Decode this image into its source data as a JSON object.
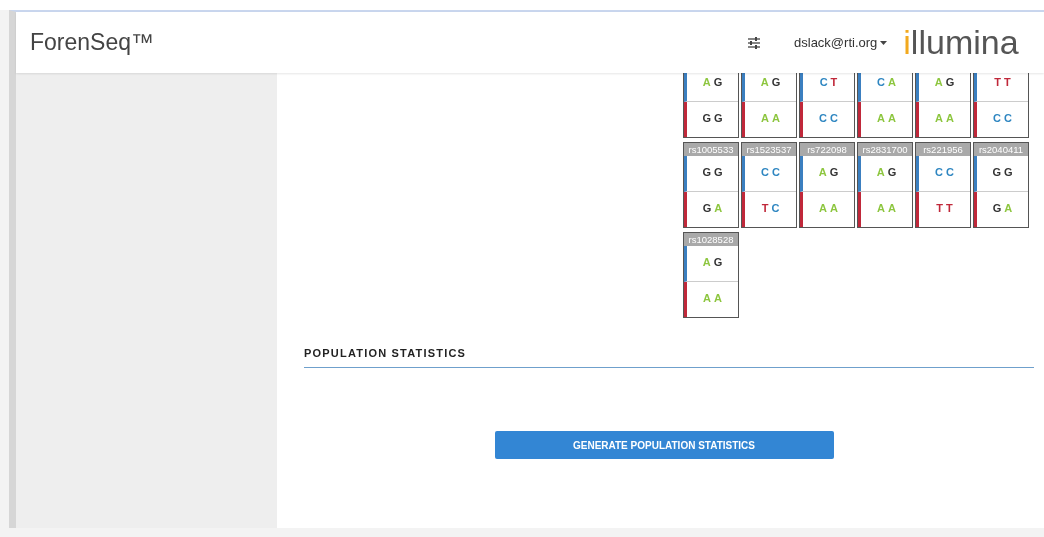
{
  "header": {
    "brand": "ForenSeq™",
    "user": "dslack@rti.org",
    "logo": "illumina"
  },
  "cards": [
    {
      "top": [
        {
          "base": "A",
          "color": "#8dc63f"
        },
        {
          "base": "G",
          "color": "#333333"
        }
      ],
      "bottom": [
        {
          "base": "G",
          "color": "#333333"
        },
        {
          "base": "G",
          "color": "#333333"
        }
      ]
    },
    {
      "top": [
        {
          "base": "A",
          "color": "#8dc63f"
        },
        {
          "base": "G",
          "color": "#333333"
        }
      ],
      "bottom": [
        {
          "base": "A",
          "color": "#8dc63f"
        },
        {
          "base": "A",
          "color": "#8dc63f"
        }
      ]
    },
    {
      "top": [
        {
          "base": "C",
          "color": "#2e86c1"
        },
        {
          "base": "T",
          "color": "#c0283a"
        }
      ],
      "bottom": [
        {
          "base": "C",
          "color": "#2e86c1"
        },
        {
          "base": "C",
          "color": "#2e86c1"
        }
      ]
    },
    {
      "top": [
        {
          "base": "C",
          "color": "#2e86c1"
        },
        {
          "base": "A",
          "color": "#8dc63f"
        }
      ],
      "bottom": [
        {
          "base": "A",
          "color": "#8dc63f"
        },
        {
          "base": "A",
          "color": "#8dc63f"
        }
      ]
    },
    {
      "top": [
        {
          "base": "A",
          "color": "#8dc63f"
        },
        {
          "base": "G",
          "color": "#333333"
        }
      ],
      "bottom": [
        {
          "base": "A",
          "color": "#8dc63f"
        },
        {
          "base": "A",
          "color": "#8dc63f"
        }
      ]
    },
    {
      "top": [
        {
          "base": "T",
          "color": "#c0283a"
        },
        {
          "base": "T",
          "color": "#c0283a"
        }
      ],
      "bottom": [
        {
          "base": "C",
          "color": "#2e86c1"
        },
        {
          "base": "C",
          "color": "#2e86c1"
        }
      ]
    },
    {
      "label": "rs1005533",
      "top": [
        {
          "base": "G",
          "color": "#333333"
        },
        {
          "base": "G",
          "color": "#333333"
        }
      ],
      "bottom": [
        {
          "base": "G",
          "color": "#333333"
        },
        {
          "base": "A",
          "color": "#8dc63f"
        }
      ]
    },
    {
      "label": "rs1523537",
      "top": [
        {
          "base": "C",
          "color": "#2e86c1"
        },
        {
          "base": "C",
          "color": "#2e86c1"
        }
      ],
      "bottom": [
        {
          "base": "T",
          "color": "#c0283a"
        },
        {
          "base": "C",
          "color": "#2e86c1"
        }
      ]
    },
    {
      "label": "rs722098",
      "top": [
        {
          "base": "A",
          "color": "#8dc63f"
        },
        {
          "base": "G",
          "color": "#333333"
        }
      ],
      "bottom": [
        {
          "base": "A",
          "color": "#8dc63f"
        },
        {
          "base": "A",
          "color": "#8dc63f"
        }
      ]
    },
    {
      "label": "rs2831700",
      "top": [
        {
          "base": "A",
          "color": "#8dc63f"
        },
        {
          "base": "G",
          "color": "#333333"
        }
      ],
      "bottom": [
        {
          "base": "A",
          "color": "#8dc63f"
        },
        {
          "base": "A",
          "color": "#8dc63f"
        }
      ]
    },
    {
      "label": "rs221956",
      "top": [
        {
          "base": "C",
          "color": "#2e86c1"
        },
        {
          "base": "C",
          "color": "#2e86c1"
        }
      ],
      "bottom": [
        {
          "base": "T",
          "color": "#c0283a"
        },
        {
          "base": "T",
          "color": "#c0283a"
        }
      ]
    },
    {
      "label": "rs2040411",
      "top": [
        {
          "base": "G",
          "color": "#333333"
        },
        {
          "base": "G",
          "color": "#333333"
        }
      ],
      "bottom": [
        {
          "base": "G",
          "color": "#333333"
        },
        {
          "base": "A",
          "color": "#8dc63f"
        }
      ]
    },
    {
      "label": "rs1028528",
      "top": [
        {
          "base": "A",
          "color": "#8dc63f"
        },
        {
          "base": "G",
          "color": "#333333"
        }
      ],
      "bottom": [
        {
          "base": "A",
          "color": "#8dc63f"
        },
        {
          "base": "A",
          "color": "#8dc63f"
        }
      ]
    }
  ],
  "population": {
    "title": "POPULATION STATISTICS",
    "button": "GENERATE POPULATION STATISTICS"
  }
}
